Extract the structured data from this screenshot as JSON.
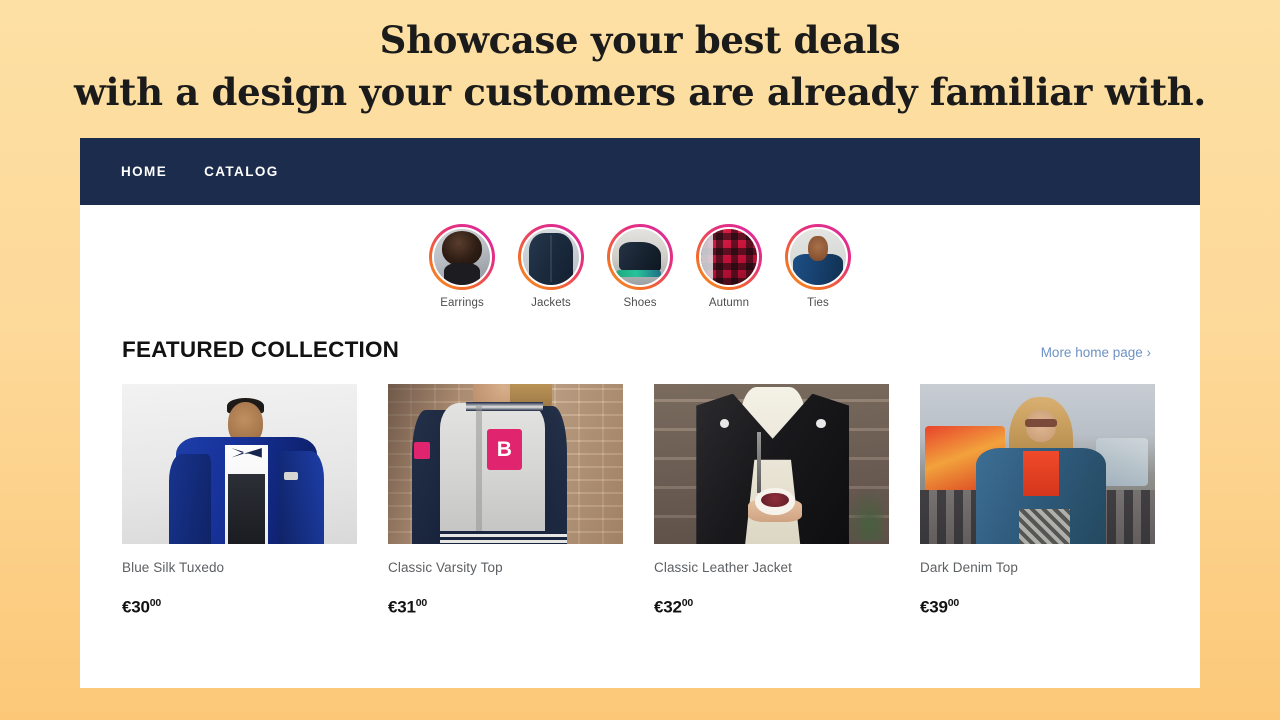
{
  "headline": {
    "line1": "Showcase your best deals",
    "line2": "with a design your customers are already familiar with."
  },
  "colors": {
    "background_top": "#fde0a4",
    "background_bottom": "#fcc878",
    "navbar": "#1c2c4c",
    "panel": "#ffffff",
    "link": "#6d92c4",
    "story_ring_start": "#f7941e",
    "story_ring_end": "#d62ba0",
    "price_text": "#121212",
    "product_title": "#5d6063"
  },
  "navbar": {
    "items": [
      {
        "label": "HOME",
        "name": "nav-item-home"
      },
      {
        "label": "CATALOG",
        "name": "nav-item-catalog"
      }
    ]
  },
  "stories": [
    {
      "label": "Earrings",
      "thumb": "woman-curly-hair-earrings"
    },
    {
      "label": "Jackets",
      "thumb": "navy-jacket-back"
    },
    {
      "label": "Shoes",
      "thumb": "dark-sneakers"
    },
    {
      "label": "Autumn",
      "thumb": "red-black-plaid-flannel"
    },
    {
      "label": "Ties",
      "thumb": "man-bow-tie"
    }
  ],
  "section": {
    "title": "FEATURED COLLECTION",
    "link_label": "More home page ›"
  },
  "products": [
    {
      "title": "Blue Silk Tuxedo",
      "currency": "€",
      "amount": "30",
      "cents": "00",
      "image": "man-in-blue-tuxedo-studio"
    },
    {
      "title": "Classic Varsity Top",
      "currency": "€",
      "amount": "31",
      "cents": "00",
      "image": "varsity-jacket-letter-b-brick-wall",
      "letter": "B"
    },
    {
      "title": "Classic Leather Jacket",
      "currency": "€",
      "amount": "32",
      "cents": "00",
      "image": "black-leather-jacket-holding-cup-wood-wall"
    },
    {
      "title": "Dark Denim Top",
      "currency": "€",
      "amount": "39",
      "cents": "00",
      "image": "denim-jacket-woman-carnival"
    }
  ]
}
